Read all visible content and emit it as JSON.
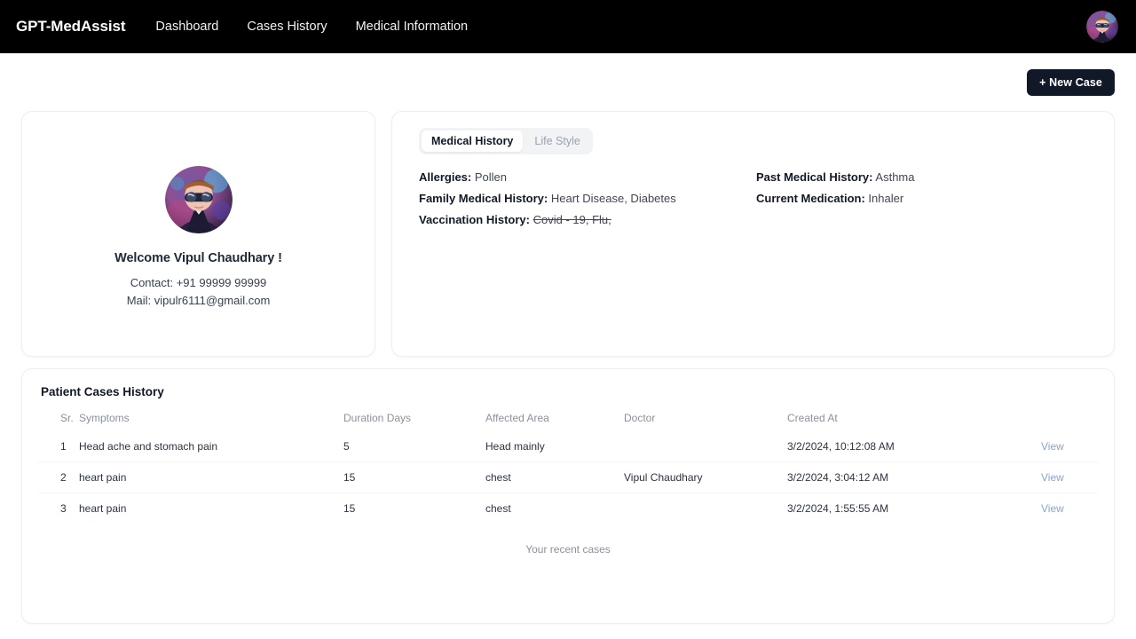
{
  "navbar": {
    "brand": "GPT-MedAssist",
    "links": [
      {
        "label": "Dashboard"
      },
      {
        "label": "Cases History"
      },
      {
        "label": "Medical Information"
      }
    ],
    "avatar_icon": "user-avatar-icon"
  },
  "toolbar": {
    "new_case_label": "+ New Case"
  },
  "profile": {
    "avatar_icon": "user-avatar-icon",
    "welcome": "Welcome Vipul Chaudhary !",
    "contact": "Contact: +91 99999 99999",
    "mail": "Mail: vipulr6111@gmail.com"
  },
  "medical": {
    "tabs": [
      {
        "label": "Medical History",
        "active": true
      },
      {
        "label": "Life Style",
        "active": false
      }
    ],
    "fields_left": [
      {
        "label": "Allergies:",
        "value": "Pollen",
        "struck": false
      },
      {
        "label": "Family Medical History:",
        "value": "Heart Disease, Diabetes",
        "struck": false
      },
      {
        "label": "Vaccination History:",
        "value": "Covid - 19, Flu,",
        "struck": true
      }
    ],
    "fields_right": [
      {
        "label": "Past Medical History:",
        "value": "Asthma",
        "struck": false
      },
      {
        "label": "Current Medication:",
        "value": "Inhaler",
        "struck": false
      }
    ]
  },
  "cases": {
    "title": "Patient Cases History",
    "columns": [
      "Sr.",
      "Symptoms",
      "Duration Days",
      "Affected Area",
      "Doctor",
      "Created At",
      ""
    ],
    "rows": [
      {
        "sr": "1",
        "symptoms": "Head ache and stomach pain",
        "duration": "5",
        "area": "Head mainly",
        "doctor": "",
        "created": "3/2/2024, 10:12:08 AM",
        "action": "View"
      },
      {
        "sr": "2",
        "symptoms": "heart pain",
        "duration": "15",
        "area": "chest",
        "doctor": "Vipul Chaudhary",
        "created": "3/2/2024, 3:04:12 AM",
        "action": "View"
      },
      {
        "sr": "3",
        "symptoms": "heart pain",
        "duration": "15",
        "area": "chest",
        "doctor": "",
        "created": "3/2/2024, 1:55:55 AM",
        "action": "View"
      }
    ],
    "caption": "Your recent cases"
  },
  "colors": {
    "navbar_bg": "#000000",
    "button_bg": "#111827",
    "page_bg": "#ffffff",
    "card_border": "#eceef1",
    "link": "#8ba4c9",
    "muted_text": "#8b929c"
  }
}
